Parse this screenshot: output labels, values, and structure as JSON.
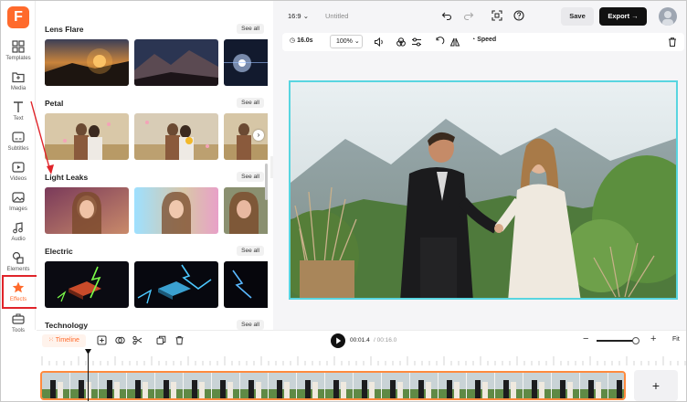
{
  "rail": {
    "items": [
      {
        "label": "Templates",
        "icon": "templates-icon"
      },
      {
        "label": "Media",
        "icon": "media-icon"
      },
      {
        "label": "Text",
        "icon": "text-icon"
      },
      {
        "label": "Subtitles",
        "icon": "subtitles-icon"
      },
      {
        "label": "Videos",
        "icon": "videos-icon"
      },
      {
        "label": "Images",
        "icon": "images-icon"
      },
      {
        "label": "Audio",
        "icon": "audio-icon"
      },
      {
        "label": "Elements",
        "icon": "elements-icon"
      },
      {
        "label": "Effects",
        "icon": "effects-icon"
      },
      {
        "label": "Tools",
        "icon": "tools-icon"
      }
    ],
    "active": "Effects",
    "logo": "F"
  },
  "panel": {
    "sections": [
      {
        "title": "Lens Flare",
        "see_all": "See all"
      },
      {
        "title": "Petal",
        "see_all": "See all"
      },
      {
        "title": "Light Leaks",
        "see_all": "See all"
      },
      {
        "title": "Electric",
        "see_all": "See all"
      },
      {
        "title": "Technology",
        "see_all": "See all"
      }
    ],
    "next_glyph": "›"
  },
  "topbar": {
    "ratio": "16:9",
    "title": "Untitled",
    "save": "Save",
    "export": "Export"
  },
  "toolbar2": {
    "duration": "16.0s",
    "zoom": "100%",
    "speed": "Speed"
  },
  "timeline": {
    "tab": "Timeline",
    "current": "00:01.4",
    "total": "/ 00:16.0",
    "fit": "Fit",
    "add": "+"
  },
  "colors": {
    "accent": "#ff6a2c",
    "highlight": "#e0242a",
    "canvas_border": "#58d5e0",
    "track_border": "#ff8a3d"
  }
}
